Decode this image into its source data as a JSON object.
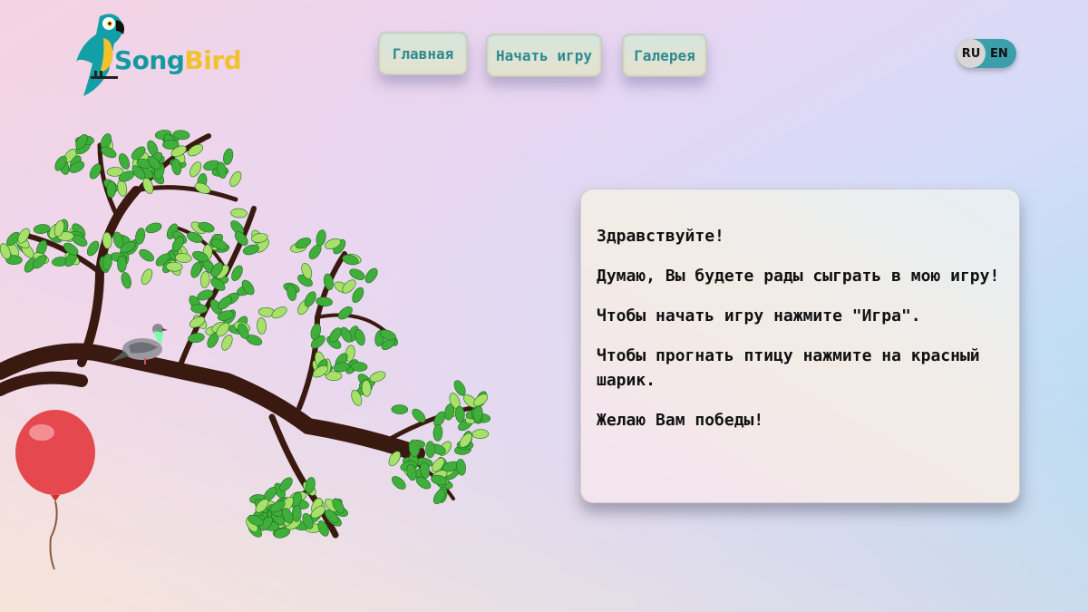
{
  "logo": {
    "text_part1": "Song",
    "text_part2": "Bird",
    "colors": {
      "song": "#129aa0",
      "bird": "#f2c12e"
    },
    "icon": "parrot-icon"
  },
  "nav": {
    "items": [
      {
        "label": "Главная"
      },
      {
        "label": "Начать игру"
      },
      {
        "label": "Галерея"
      }
    ]
  },
  "language": {
    "options": [
      "RU",
      "EN"
    ],
    "selected": "RU"
  },
  "card": {
    "paragraphs": [
      "Здравствуйте!",
      "Думаю, Вы будете рады сыграть в мою игру!",
      "Чтобы начать игру нажмите \"Игра\".",
      "Чтобы прогнать птицу нажмите на красный шарик.",
      "Желаю Вам победы!"
    ]
  },
  "scene": {
    "elements": [
      "tree-branch-illustration",
      "pigeon-icon",
      "red-balloon-icon"
    ],
    "balloon_color": "#e5494f"
  },
  "colors": {
    "accent": "#2f8a8f",
    "toggle": "#3a9faa"
  }
}
